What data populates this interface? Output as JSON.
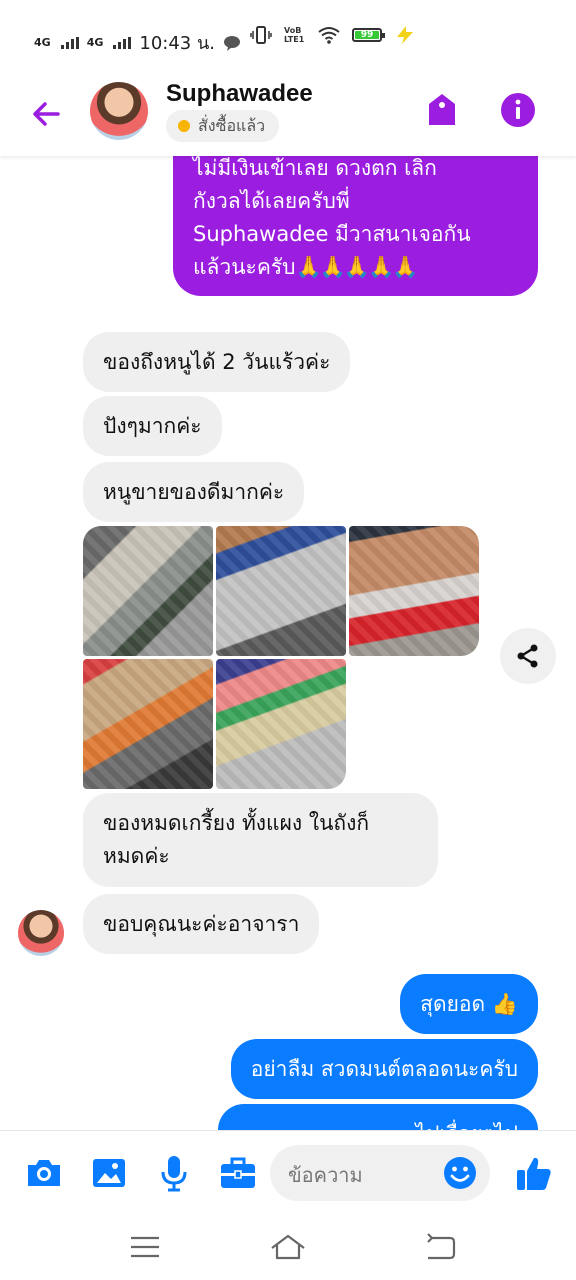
{
  "status_bar": {
    "network1": "4G",
    "network2": "4G",
    "time": "10:43 น.",
    "volte": "VoB LTE1",
    "battery": "99"
  },
  "header": {
    "contact_name": "Suphawadee",
    "order_status": "สั่งซื้อแล้ว"
  },
  "messages": {
    "outgoing_top": {
      "line1": "ไม่มีเงินเข้าเลย ดวงตก เลิก",
      "line2": "กังวลได้เลยครับพี่",
      "line3": "Suphawadee  มีวาสนาเจอกัน",
      "line4": "แล้วนะครับ",
      "emoji": "🙏🙏🙏🙏🙏"
    },
    "incoming": [
      "ของถึงหนูได้ 2 วันแร้วค่ะ",
      "ปังๆมากค่ะ",
      "หนูขายของดีมากค่ะ"
    ],
    "incoming_after_photos": {
      "line1": "ของหมดเกรี้ยง ทั้งแผง ในถังก็",
      "line2": "หมดค่ะ"
    },
    "incoming_last": "ขอบคุณนะค่ะอาจารา",
    "outgoing_bottom": [
      "สุดยอด 👍",
      "อย่าลืม สวดมนต์ตลอดนะครับ",
      "...ไปเรื่อยๆไป"
    ]
  },
  "photos": [
    "stall-photo-1",
    "stall-photo-2",
    "stall-photo-3",
    "stall-photo-4",
    "stall-photo-5"
  ],
  "composer": {
    "placeholder": "ข้อความ"
  },
  "colors": {
    "accent_purple": "#9b1ee0",
    "accent_blue": "#0a7cff",
    "incoming_bubble": "#efefef",
    "online_dot": "#f7b500"
  },
  "icons": {
    "header": [
      "back-arrow-icon",
      "tag-icon",
      "info-icon"
    ],
    "composer": [
      "camera-icon",
      "gallery-icon",
      "microphone-icon",
      "toolbox-icon",
      "emoji-icon",
      "thumbs-up-icon"
    ],
    "nav": [
      "menu-icon",
      "home-icon",
      "back-icon"
    ]
  }
}
